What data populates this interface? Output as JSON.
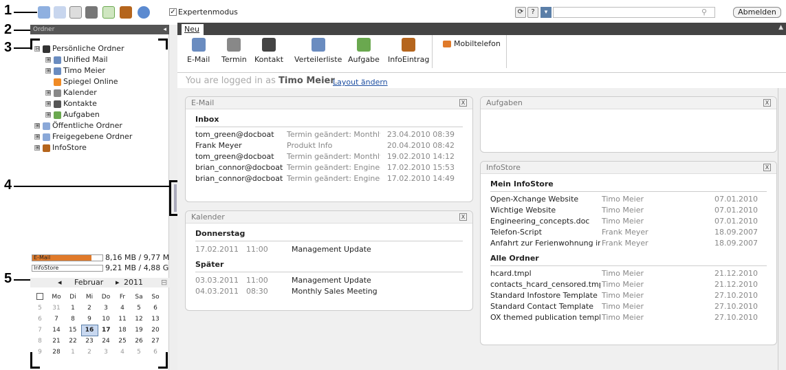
{
  "callouts": [
    "1",
    "2",
    "3",
    "4",
    "5"
  ],
  "toolbar": {
    "icons": [
      "home-icon",
      "mail-icon",
      "calendar-icon",
      "contacts-icon",
      "tasks-icon",
      "infostore-icon",
      "settings-icon"
    ],
    "expert_checkbox_mark": "✓",
    "expert_label": "Expertenmodus",
    "refresh_glyph": "⟳",
    "help_glyph": "?",
    "dropdown_glyph": "▾",
    "search_placeholder": "",
    "search_glyph": "⚲",
    "logout_label": "Abmelden"
  },
  "left": {
    "header": "Ordner",
    "collapse_glyph": "◂",
    "tree": [
      {
        "level": 0,
        "expander": "⊟",
        "label": "Persönliche Ordner",
        "icon": "user-folder-icon",
        "color": "#333"
      },
      {
        "level": 1,
        "expander": "⊞",
        "label": "Unified Mail",
        "icon": "mail-icon",
        "color": "#6a8cc0"
      },
      {
        "level": 1,
        "expander": "⊞",
        "label": "Timo Meier",
        "icon": "mail-icon",
        "color": "#6a8cc0"
      },
      {
        "level": 1,
        "expander": "",
        "label": "Spiegel Online",
        "icon": "rss-icon",
        "color": "#f08a24"
      },
      {
        "level": 1,
        "expander": "⊞",
        "label": "Kalender",
        "icon": "calendar-icon",
        "color": "#888"
      },
      {
        "level": 1,
        "expander": "⊞",
        "label": "Kontakte",
        "icon": "contacts-icon",
        "color": "#555"
      },
      {
        "level": 1,
        "expander": "⊞",
        "label": "Aufgaben",
        "icon": "tasks-icon",
        "color": "#6aa84f"
      },
      {
        "level": 0,
        "expander": "⊞",
        "label": "Öffentliche Ordner",
        "icon": "public-folder-icon",
        "color": "#8aa8d8"
      },
      {
        "level": 0,
        "expander": "⊞",
        "label": "Freigegebene Ordner",
        "icon": "shared-folder-icon",
        "color": "#8aa8d8"
      },
      {
        "level": 0,
        "expander": "⊞",
        "label": "InfoStore",
        "icon": "infostore-icon",
        "color": "#b5651d"
      }
    ],
    "quota": [
      {
        "label": "E-Mail",
        "value": "8,16 MB / 9,77 MB",
        "fill": 0.84
      },
      {
        "label": "InfoStore",
        "value": "9,21 MB / 4,88 GB",
        "fill": 0.0
      }
    ],
    "calendar": {
      "prev": "◂",
      "month": "Februar",
      "next": "▸",
      "year": "2011",
      "close": "⊟",
      "weekhead": "[week]",
      "days": [
        "Mo",
        "Di",
        "Mi",
        "Do",
        "Fr",
        "Sa",
        "So"
      ],
      "rows": [
        [
          "5",
          "31",
          "1",
          "2",
          "3",
          "4",
          "5",
          "6"
        ],
        [
          "6",
          "7",
          "8",
          "9",
          "10",
          "11",
          "12",
          "13"
        ],
        [
          "7",
          "14",
          "15",
          "16",
          "17",
          "18",
          "19",
          "20"
        ],
        [
          "8",
          "21",
          "22",
          "23",
          "24",
          "25",
          "26",
          "27"
        ],
        [
          "9",
          "28",
          "1",
          "2",
          "3",
          "4",
          "5",
          "6"
        ]
      ],
      "today": "16"
    }
  },
  "tabs": [
    "Neu"
  ],
  "ribbon": [
    {
      "label": "E-Mail",
      "icon": "mail-icon",
      "color": "#6a8cc0"
    },
    {
      "label": "Termin",
      "icon": "calendar-icon",
      "color": "#888"
    },
    {
      "label": "Kontakt",
      "icon": "contact-icon",
      "color": "#444"
    },
    {
      "label": "Verteilerliste",
      "icon": "distribution-list-icon",
      "color": "#6a8cc0"
    },
    {
      "label": "Aufgabe",
      "icon": "task-icon",
      "color": "#6aa84f"
    },
    {
      "label": "InfoEintrag",
      "icon": "infostore-icon",
      "color": "#b5651d"
    }
  ],
  "ribbon_extra": {
    "label": "Mobiltelefon",
    "icon": "phone-icon"
  },
  "loggedin": {
    "prefix": "You are logged in as",
    "user": "Timo Meier",
    "suffix": ".",
    "layout_link": "Layout ändern"
  },
  "widgets": {
    "email": {
      "title": "E-Mail",
      "close": "X",
      "section": "Inbox",
      "rows": [
        {
          "from": "tom_green@docboat",
          "subject": "Termin geändert: Monthly S",
          "date": "23.04.2010 08:39"
        },
        {
          "from": "Frank Meyer",
          "subject": "Produkt Info",
          "date": "20.04.2010 08:42"
        },
        {
          "from": "tom_green@docboat",
          "subject": "Termin geändert: Monthly S",
          "date": "19.02.2010 14:12"
        },
        {
          "from": "brian_connor@docboat",
          "subject": "Termin geändert: Engineeri",
          "date": "17.02.2010 15:53"
        },
        {
          "from": "brian_connor@docboat",
          "subject": "Termin geändert: Engineeri",
          "date": "17.02.2010 14:49"
        }
      ]
    },
    "calendar": {
      "title": "Kalender",
      "close": "X",
      "groups": [
        {
          "label": "Donnerstag",
          "items": [
            {
              "date": "17.02.2011",
              "time": "11:00",
              "title": "Management Update"
            }
          ]
        },
        {
          "label": "Später",
          "items": [
            {
              "date": "03.03.2011",
              "time": "11:00",
              "title": "Management Update"
            },
            {
              "date": "04.03.2011",
              "time": "08:30",
              "title": "Monthly Sales Meeting"
            }
          ]
        }
      ]
    },
    "tasks": {
      "title": "Aufgaben",
      "close": "X"
    },
    "infostore": {
      "title": "InfoStore",
      "close": "X",
      "sections": [
        {
          "label": "Mein InfoStore",
          "rows": [
            {
              "name": "Open-Xchange Website",
              "owner": "Timo Meier",
              "date": "07.01.2010"
            },
            {
              "name": "Wichtige Website",
              "owner": "Timo Meier",
              "date": "07.01.2010"
            },
            {
              "name": "Engineering_concepts.doc",
              "owner": "Timo Meier",
              "date": "07.01.2010"
            },
            {
              "name": "Telefon-Script",
              "owner": "Frank Meyer",
              "date": "18.09.2007"
            },
            {
              "name": "Anfahrt zur Ferienwohnung in Rei",
              "owner": "Frank Meyer",
              "date": "18.09.2007"
            }
          ]
        },
        {
          "label": "Alle Ordner",
          "rows": [
            {
              "name": "hcard.tmpl",
              "owner": "Timo Meier",
              "date": "21.12.2010"
            },
            {
              "name": "contacts_hcard_censored.tmpl",
              "owner": "Timo Meier",
              "date": "21.12.2010"
            },
            {
              "name": "Standard Infostore Template",
              "owner": "Timo Meier",
              "date": "27.10.2010"
            },
            {
              "name": "Standard Contact Template",
              "owner": "Timo Meier",
              "date": "27.10.2010"
            },
            {
              "name": "OX themed publication template",
              "owner": "Timo Meier",
              "date": "27.10.2010"
            }
          ]
        }
      ]
    }
  },
  "colors": {
    "accent": "#1a4ca0",
    "dark_bar": "#444444",
    "quota_fill": "#e07a2a"
  }
}
